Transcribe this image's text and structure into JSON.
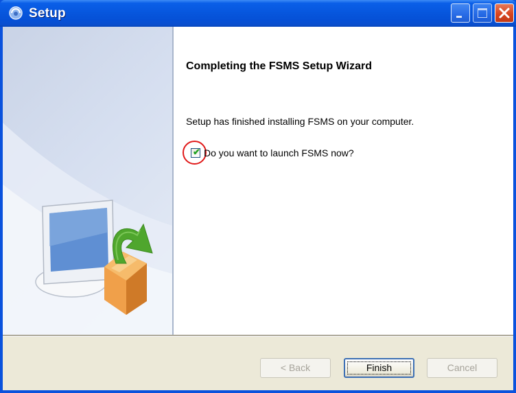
{
  "window": {
    "title": "Setup",
    "title_icon": "setup-icon"
  },
  "content": {
    "heading": "Completing the FSMS Setup Wizard",
    "description": "Setup has finished installing FSMS on your computer.",
    "launch_checkbox": {
      "label": "Do you want to launch FSMS now?",
      "checked": true
    }
  },
  "buttons": {
    "back": "< Back",
    "finish": "Finish",
    "cancel": "Cancel"
  },
  "colors": {
    "titlebar": "#0757de",
    "highlight_ring": "#e01818",
    "check": "#21a121"
  }
}
